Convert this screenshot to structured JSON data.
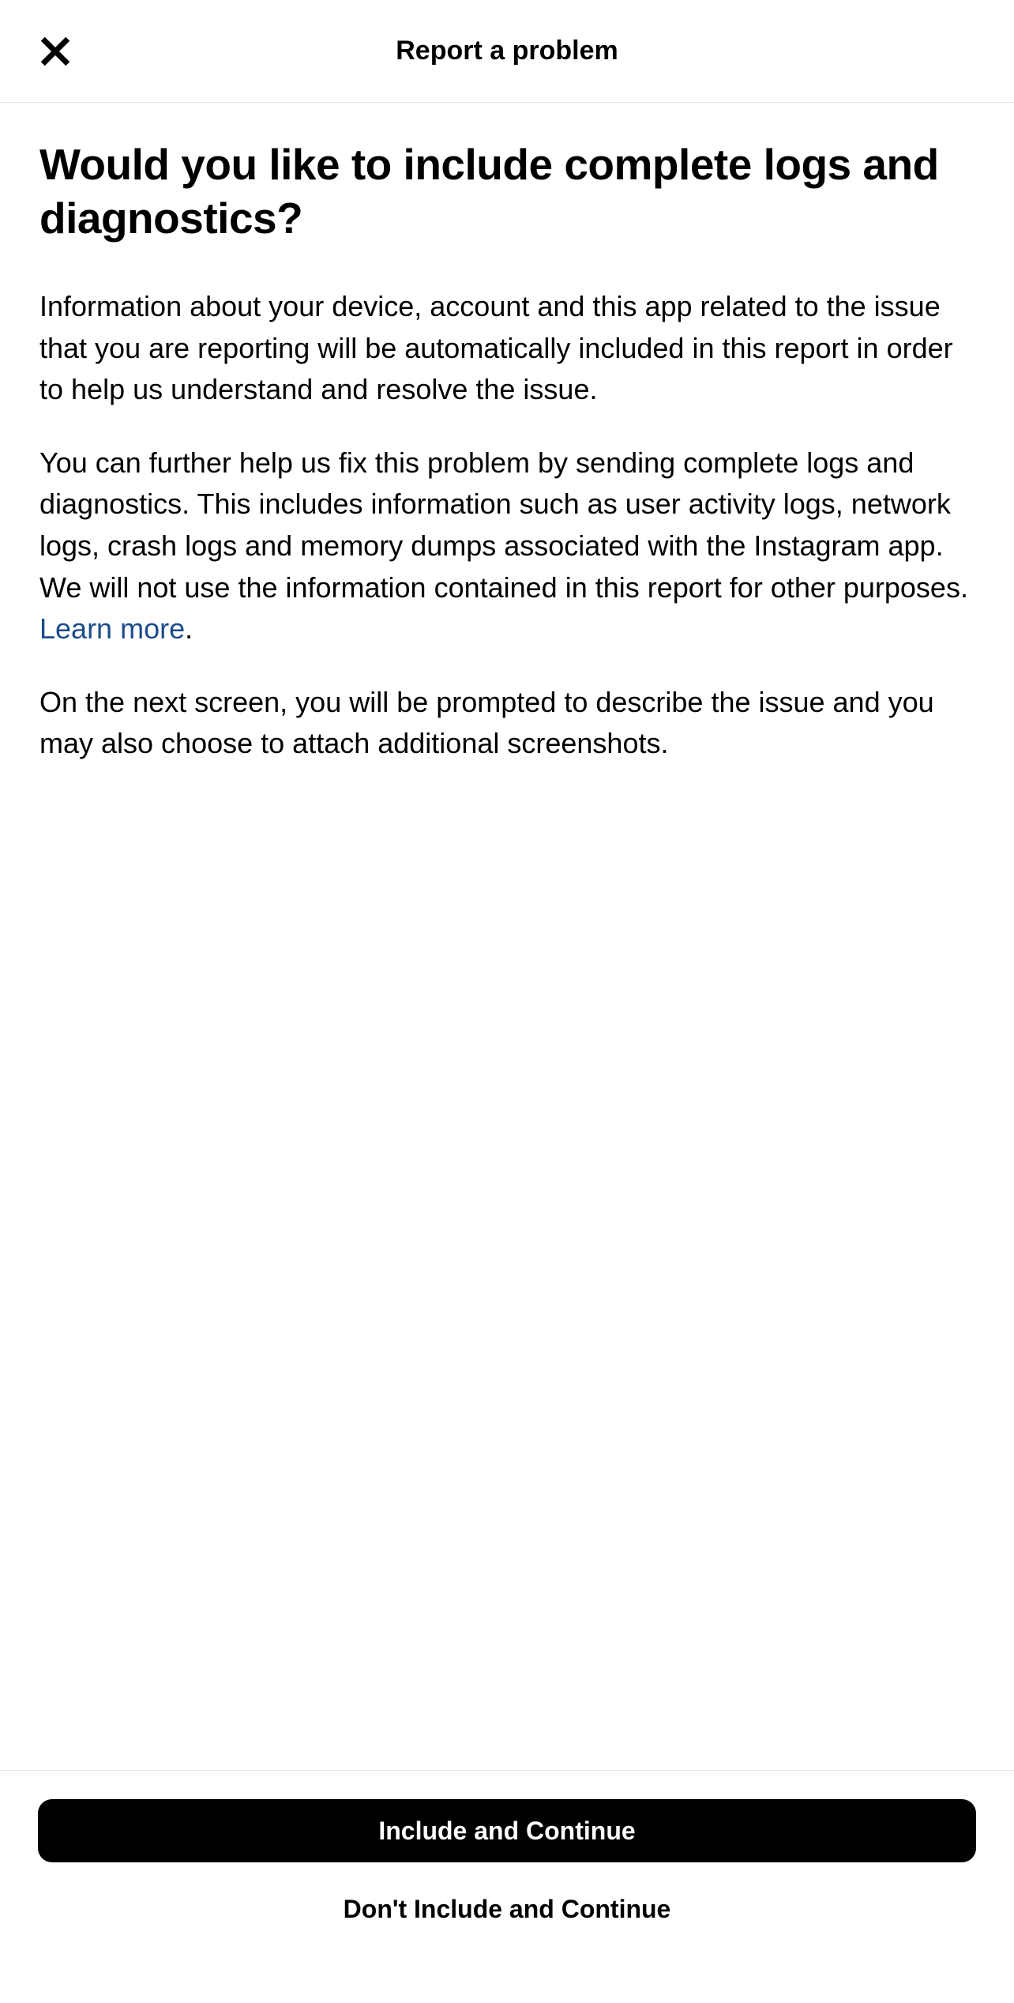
{
  "header": {
    "title": "Report a problem"
  },
  "content": {
    "heading": "Would you like to include complete logs and diagnostics?",
    "paragraph1": "Information about your device, account and this app related to the issue that you are reporting will be automatically included in this report in order to help us understand and resolve the issue.",
    "paragraph2_before_link": "You can further help us fix this problem by sending complete logs and diagnostics. This includes information such as user activity logs, network logs, crash logs and memory dumps associated with the Instagram app. We will not use the information contained in this report for other purposes. ",
    "learn_more_label": "Learn more",
    "paragraph2_after_link": ".",
    "paragraph3": "On the next screen, you will be prompted to describe the issue and you may also choose to attach additional screenshots."
  },
  "footer": {
    "primary_button_label": "Include and Continue",
    "secondary_button_label": "Don't Include and Continue"
  }
}
